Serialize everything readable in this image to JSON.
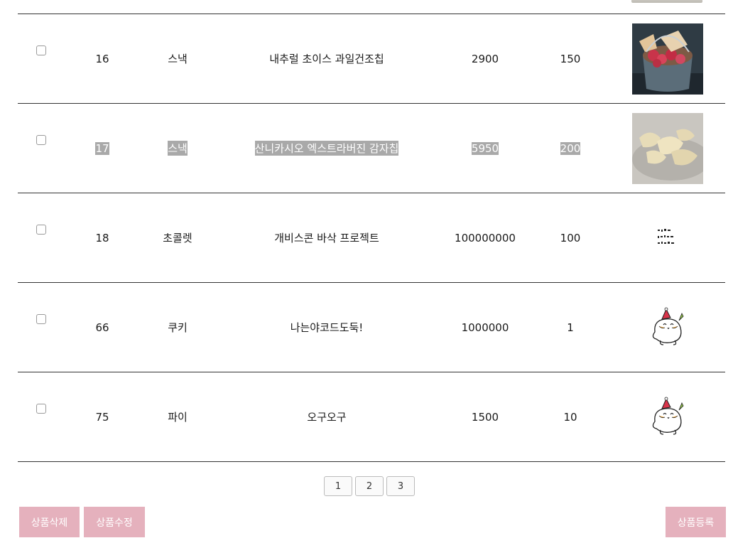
{
  "products": [
    {
      "id": "16",
      "category": "스낵",
      "name": "내추럴 초이스 과일건조칩",
      "price": "2900",
      "stock": "150",
      "image": "dried-fruit-bucket",
      "selected": false
    },
    {
      "id": "17",
      "category": "스낵",
      "name": "산니카시오 엑스트라버진 감자칩",
      "price": "5950",
      "stock": "200",
      "image": "potato-chips-plate",
      "selected": false
    },
    {
      "id": "18",
      "category": "초콜렛",
      "name": "개비스콘 바삭 프로젝트",
      "price": "100000000",
      "stock": "100",
      "image": "tiny-text-sticker",
      "selected": false
    },
    {
      "id": "66",
      "category": "쿠키",
      "name": "나는야코드도둑!",
      "price": "1000000",
      "stock": "1",
      "image": "cartoon-bear-sticker",
      "selected": false
    },
    {
      "id": "75",
      "category": "파이",
      "name": "오구오구",
      "price": "1500",
      "stock": "10",
      "image": "cartoon-bear-sticker",
      "selected": false
    }
  ],
  "pagination": {
    "pages": [
      "1",
      "2",
      "3"
    ]
  },
  "actions": {
    "delete_label": "상품삭제",
    "edit_label": "상품수정",
    "register_label": "상품등록"
  },
  "colors": {
    "button_bg": "#e5b1bd",
    "highlight_bg": "#a9a9a9",
    "row_border": "#333333"
  }
}
